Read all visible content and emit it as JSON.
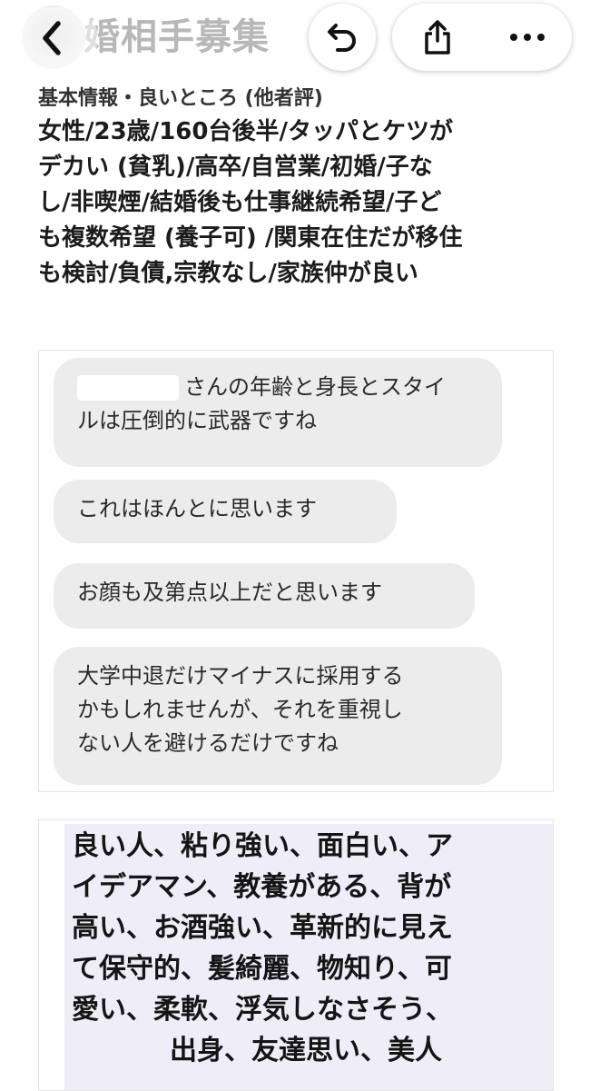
{
  "header": {
    "title": "婚相手募集"
  },
  "profile": {
    "heading": "基本情報・良いところ (他者評)",
    "lines": [
      "女性/23歳/160台後半/タッパとケツが",
      "デカい (貧乳)/高卒/自営業/初婚/子な",
      "し/非喫煙/結婚後も仕事継続希望/子ど",
      "も複数希望 (養子可) /関東在住だが移住",
      "も検討/負債,宗教なし/家族仲が良い"
    ]
  },
  "messages": [
    {
      "lines": [
        "さんの年齢と身長とスタイ",
        "ルは圧倒的に武器ですね"
      ]
    },
    {
      "lines": [
        "これはほんとに思います"
      ]
    },
    {
      "lines": [
        "お顔も及第点以上だと思います"
      ]
    },
    {
      "lines": [
        "大学中退だけマイナスに採用する",
        "かもしれませんが、それを重視し",
        "ない人を避けるだけですね"
      ]
    }
  ],
  "traits": {
    "lines": [
      "良い人、粘り強い、面白い、ア",
      "イデアマン、教養がある、背が",
      "高い、お酒強い、革新的に見え",
      "て保守的、髪綺麗、物知り、可",
      "愛い、柔軟、浮気しなさそう、",
      "出身、友達思い、美人"
    ]
  },
  "icons": {
    "back": "chevron-left-icon",
    "reply": "reply-arrow-icon",
    "share": "share-icon",
    "more": "more-dots-icon"
  },
  "colors": {
    "bubble": "#ececec",
    "traits_card": "#efeef8",
    "title_faded": "#b8b8b8"
  }
}
